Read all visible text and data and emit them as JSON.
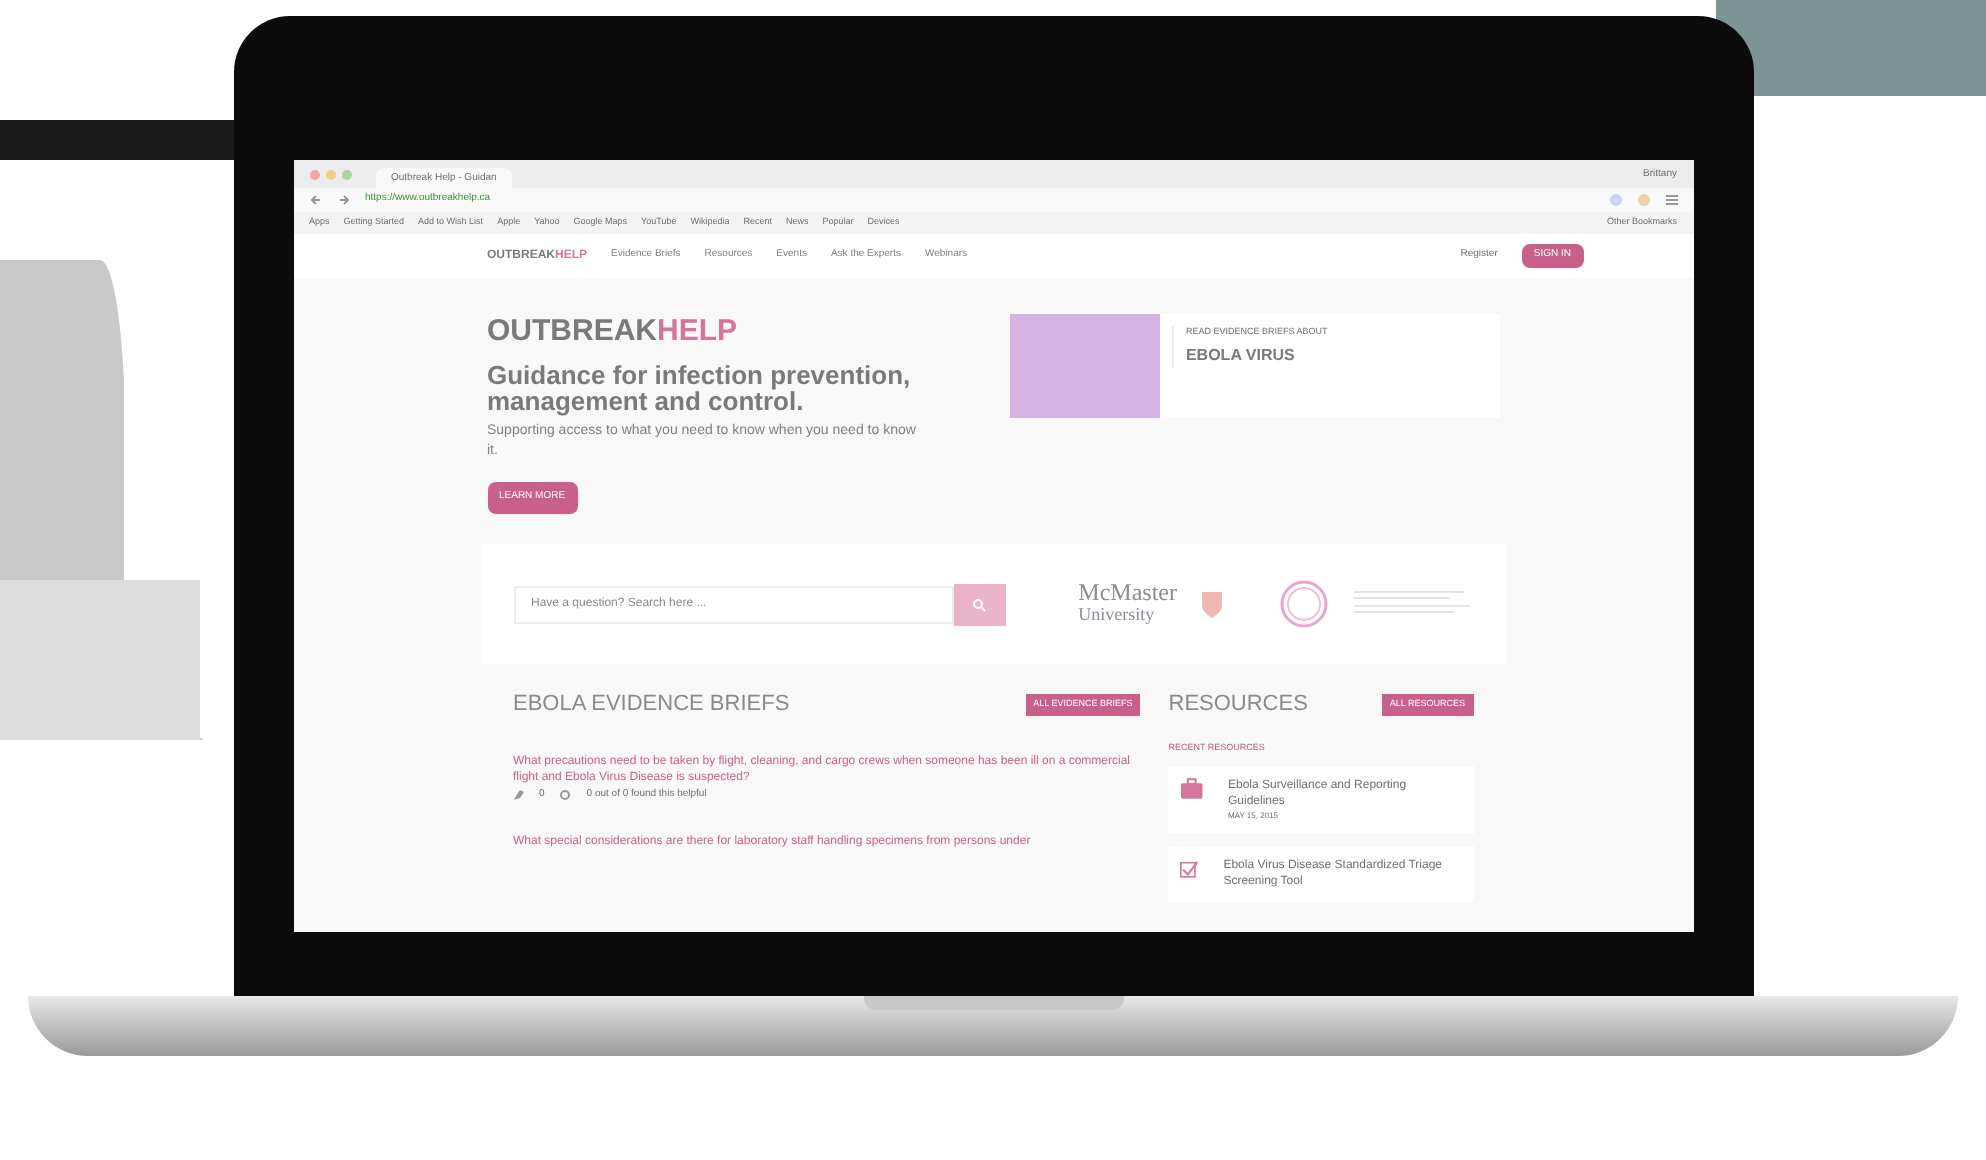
{
  "browser": {
    "tab": "Outbreak Help - Guidan",
    "url": "https://www.outbreakhelp.ca",
    "user": "Brittany",
    "bookmarks": [
      "Apps",
      "Getting Started",
      "Add to Wish List",
      "Apple",
      "Yahoo",
      "Google Maps",
      "YouTube",
      "Wikipedia",
      "Recent",
      "News",
      "Popular",
      "Devices"
    ],
    "other_bookmarks": "Other Bookmarks"
  },
  "site_nav": {
    "logo": [
      "OUTBREAK",
      "HELP"
    ],
    "links": [
      {
        "label": "Evidence Briefs",
        "selected": false
      },
      {
        "label": "Resources",
        "selected": false
      },
      {
        "label": "Events",
        "selected": false
      },
      {
        "label": "Ask the Experts",
        "selected": false
      },
      {
        "label": "Webinars",
        "selected": false
      }
    ],
    "register": "Register",
    "sign_in": "SIGN IN"
  },
  "hero": {
    "logo": [
      "OUTBREAK",
      "HELP"
    ],
    "heading": "Guidance for infection prevention, management and control.",
    "subtitle": "Supporting access to what you need to know when you need to know it.",
    "button": "LEARN MORE",
    "card": {
      "kicker": "READ EVIDENCE BRIEFS ABOUT",
      "title": "EBOLA VIRUS"
    }
  },
  "search": {
    "placeholder": "Have a question? Search here ...",
    "partner": [
      "McMaster",
      "University"
    ]
  },
  "briefs": {
    "title": "EBOLA EVIDENCE BRIEFS",
    "button": "ALL EVIDENCE BRIEFS",
    "items": [
      {
        "title": "What precautions need to be taken by flight, cleaning, and cargo crews when someone has been ill on a commercial flight and Ebola Virus Disease is suspected?",
        "comments": "0",
        "helpful": "0 out of 0 found this helpful"
      },
      {
        "title": "What special considerations are there for laboratory staff handling specimens from persons under"
      }
    ]
  },
  "resources": {
    "title": "RESOURCES",
    "button": "ALL RESOURCES",
    "subtitle": "RECENT RESOURCES",
    "items": [
      {
        "kind": "briefcase",
        "title": "Ebola Surveillance and Reporting Guidelines",
        "date": "MAY 15, 2015"
      },
      {
        "kind": "checklist",
        "title": "Ebola Virus Disease Standardized Triage Screening Tool"
      }
    ]
  }
}
